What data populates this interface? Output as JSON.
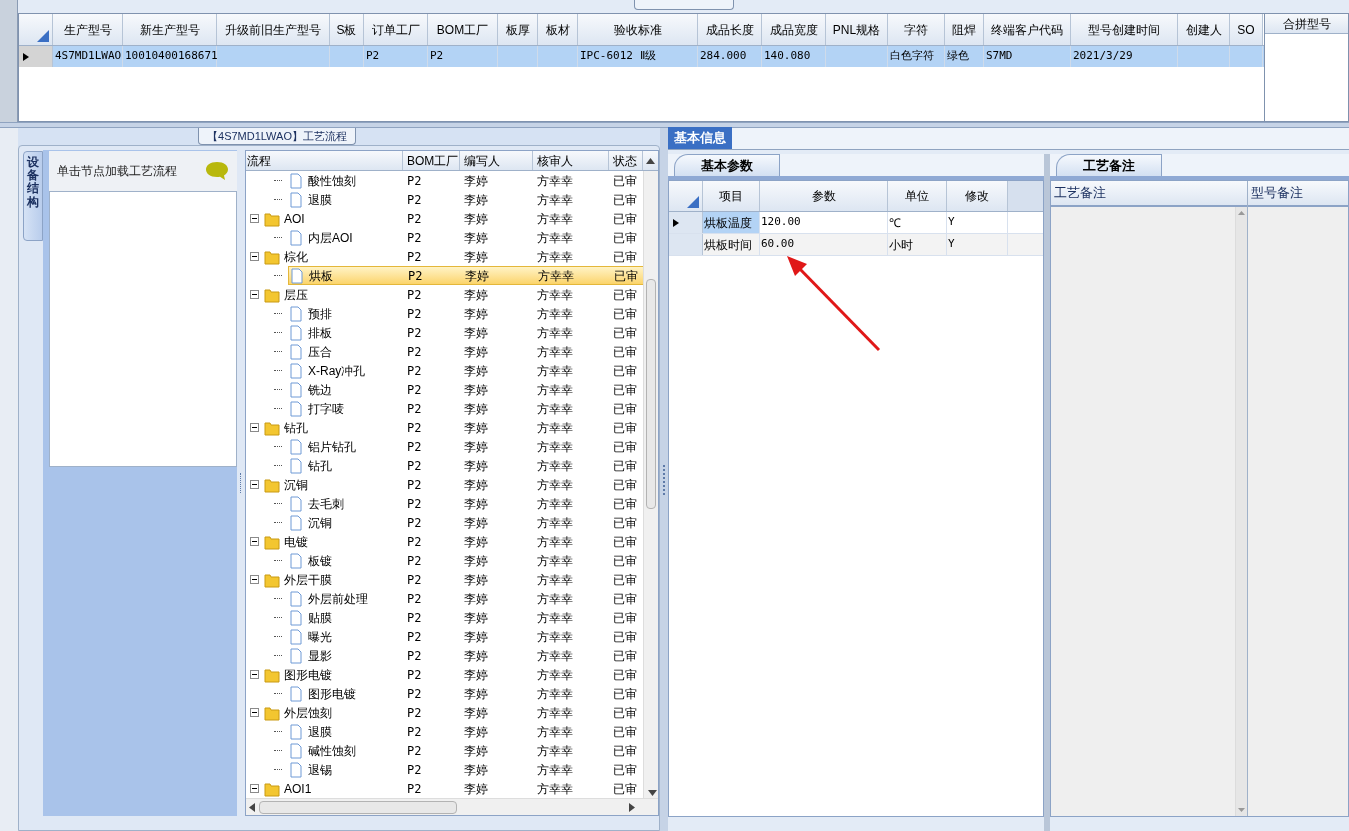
{
  "main_grid": {
    "columns": [
      "生产型号",
      "新生产型号",
      "升级前旧生产型号",
      "S板",
      "订单工厂",
      "BOM工厂",
      "板厚",
      "板材",
      "验收标准",
      "成品长度",
      "成品宽度",
      "PNL规格",
      "字符",
      "阻焊",
      "终端客户代码",
      "型号创建时间",
      "创建人",
      "SO"
    ],
    "rows": [
      {
        "selected": true,
        "cells": [
          "4S7MD1LWAO",
          "10010400168671",
          null,
          null,
          "P2",
          "P2",
          null,
          null,
          "IPC-6012 Ⅱ级",
          "284.000",
          "140.080",
          null,
          "白色字符",
          "绿色",
          "S7MD",
          "2021/3/29",
          null,
          null
        ]
      }
    ]
  },
  "merge_panel": {
    "header": "合拼型号"
  },
  "process_panel": {
    "title": "【4S7MD1LWAO】工艺流程",
    "side_tab": "设备结构",
    "hint": "单击节点加载工艺流程",
    "tree": {
      "columns": [
        "流程",
        "BOM工厂",
        "编写人",
        "核审人",
        "状态"
      ],
      "continued_children": [
        {
          "label": "酸性蚀刻",
          "kind": "doc",
          "bom": "P2",
          "writer": "李婷",
          "reviewer": "方幸幸",
          "status": "已审",
          "selected": false
        },
        {
          "label": "退膜",
          "kind": "doc",
          "bom": "P2",
          "writer": "李婷",
          "reviewer": "方幸幸",
          "status": "已审",
          "selected": false
        }
      ],
      "nodes": [
        {
          "label": "AOI",
          "kind": "folder",
          "expanded": true,
          "bom": "P2",
          "writer": "李婷",
          "reviewer": "方幸幸",
          "status": "已审",
          "selected": false,
          "children": [
            {
              "label": "内层AOI",
              "kind": "doc",
              "bom": "P2",
              "writer": "李婷",
              "reviewer": "方幸幸",
              "status": "已审",
              "selected": false
            }
          ]
        },
        {
          "label": "棕化",
          "kind": "folder",
          "expanded": true,
          "bom": "P2",
          "writer": "李婷",
          "reviewer": "方幸幸",
          "status": "已审",
          "selected": false,
          "children": [
            {
              "label": "烘板",
              "kind": "doc",
              "bom": "P2",
              "writer": "李婷",
              "reviewer": "方幸幸",
              "status": "已审",
              "selected": true
            }
          ]
        },
        {
          "label": "层压",
          "kind": "folder",
          "expanded": true,
          "bom": "P2",
          "writer": "李婷",
          "reviewer": "方幸幸",
          "status": "已审",
          "selected": false,
          "children": [
            {
              "label": "预排",
              "kind": "doc",
              "bom": "P2",
              "writer": "李婷",
              "reviewer": "方幸幸",
              "status": "已审",
              "selected": false
            },
            {
              "label": "排板",
              "kind": "doc",
              "bom": "P2",
              "writer": "李婷",
              "reviewer": "方幸幸",
              "status": "已审",
              "selected": false
            },
            {
              "label": "压合",
              "kind": "doc",
              "bom": "P2",
              "writer": "李婷",
              "reviewer": "方幸幸",
              "status": "已审",
              "selected": false
            },
            {
              "label": "X-Ray冲孔",
              "kind": "doc",
              "bom": "P2",
              "writer": "李婷",
              "reviewer": "方幸幸",
              "status": "已审",
              "selected": false
            },
            {
              "label": "铣边",
              "kind": "doc",
              "bom": "P2",
              "writer": "李婷",
              "reviewer": "方幸幸",
              "status": "已审",
              "selected": false
            },
            {
              "label": "打字唛",
              "kind": "doc",
              "bom": "P2",
              "writer": "李婷",
              "reviewer": "方幸幸",
              "status": "已审",
              "selected": false
            }
          ]
        },
        {
          "label": "钻孔",
          "kind": "folder",
          "expanded": true,
          "bom": "P2",
          "writer": "李婷",
          "reviewer": "方幸幸",
          "status": "已审",
          "selected": false,
          "children": [
            {
              "label": "铝片钻孔",
              "kind": "doc",
              "bom": "P2",
              "writer": "李婷",
              "reviewer": "方幸幸",
              "status": "已审",
              "selected": false
            },
            {
              "label": "钻孔",
              "kind": "doc",
              "bom": "P2",
              "writer": "李婷",
              "reviewer": "方幸幸",
              "status": "已审",
              "selected": false
            }
          ]
        },
        {
          "label": "沉铜",
          "kind": "folder",
          "expanded": true,
          "bom": "P2",
          "writer": "李婷",
          "reviewer": "方幸幸",
          "status": "已审",
          "selected": false,
          "children": [
            {
              "label": "去毛刺",
              "kind": "doc",
              "bom": "P2",
              "writer": "李婷",
              "reviewer": "方幸幸",
              "status": "已审",
              "selected": false
            },
            {
              "label": "沉铜",
              "kind": "doc",
              "bom": "P2",
              "writer": "李婷",
              "reviewer": "方幸幸",
              "status": "已审",
              "selected": false
            }
          ]
        },
        {
          "label": "电镀",
          "kind": "folder",
          "expanded": true,
          "bom": "P2",
          "writer": "李婷",
          "reviewer": "方幸幸",
          "status": "已审",
          "selected": false,
          "children": [
            {
              "label": "板镀",
              "kind": "doc",
              "bom": "P2",
              "writer": "李婷",
              "reviewer": "方幸幸",
              "status": "已审",
              "selected": false
            }
          ]
        },
        {
          "label": "外层干膜",
          "kind": "folder",
          "expanded": true,
          "bom": "P2",
          "writer": "李婷",
          "reviewer": "方幸幸",
          "status": "已审",
          "selected": false,
          "children": [
            {
              "label": "外层前处理",
              "kind": "doc",
              "bom": "P2",
              "writer": "李婷",
              "reviewer": "方幸幸",
              "status": "已审",
              "selected": false
            },
            {
              "label": "贴膜",
              "kind": "doc",
              "bom": "P2",
              "writer": "李婷",
              "reviewer": "方幸幸",
              "status": "已审",
              "selected": false
            },
            {
              "label": "曝光",
              "kind": "doc",
              "bom": "P2",
              "writer": "李婷",
              "reviewer": "方幸幸",
              "status": "已审",
              "selected": false
            },
            {
              "label": "显影",
              "kind": "doc",
              "bom": "P2",
              "writer": "李婷",
              "reviewer": "方幸幸",
              "status": "已审",
              "selected": false
            }
          ]
        },
        {
          "label": "图形电镀",
          "kind": "folder",
          "expanded": true,
          "bom": "P2",
          "writer": "李婷",
          "reviewer": "方幸幸",
          "status": "已审",
          "selected": false,
          "children": [
            {
              "label": "图形电镀",
              "kind": "doc",
              "bom": "P2",
              "writer": "李婷",
              "reviewer": "方幸幸",
              "status": "已审",
              "selected": false
            }
          ]
        },
        {
          "label": "外层蚀刻",
          "kind": "folder",
          "expanded": true,
          "bom": "P2",
          "writer": "李婷",
          "reviewer": "方幸幸",
          "status": "已审",
          "selected": false,
          "children": [
            {
              "label": "退膜",
              "kind": "doc",
              "bom": "P2",
              "writer": "李婷",
              "reviewer": "方幸幸",
              "status": "已审",
              "selected": false
            },
            {
              "label": "碱性蚀刻",
              "kind": "doc",
              "bom": "P2",
              "writer": "李婷",
              "reviewer": "方幸幸",
              "status": "已审",
              "selected": false
            },
            {
              "label": "退锡",
              "kind": "doc",
              "bom": "P2",
              "writer": "李婷",
              "reviewer": "方幸幸",
              "status": "已审",
              "selected": false
            }
          ]
        },
        {
          "label": "AOI1",
          "kind": "folder",
          "expanded": true,
          "bom": "P2",
          "writer": "李婷",
          "reviewer": "方幸幸",
          "status": "已审",
          "selected": false
        }
      ]
    }
  },
  "info_tab": {
    "label": "基本信息",
    "selected": true
  },
  "params": {
    "tab": "基本参数",
    "columns": [
      "项目",
      "参数",
      "单位",
      "修改"
    ],
    "rows": [
      {
        "selected": true,
        "cells": [
          "烘板温度",
          "120.00",
          "℃",
          "Y"
        ]
      },
      {
        "selected": false,
        "cells": [
          "烘板时间",
          "60.00",
          "小时",
          "Y"
        ]
      }
    ]
  },
  "notes": {
    "tab": "工艺备注",
    "columns": [
      "工艺备注",
      "型号备注"
    ]
  }
}
